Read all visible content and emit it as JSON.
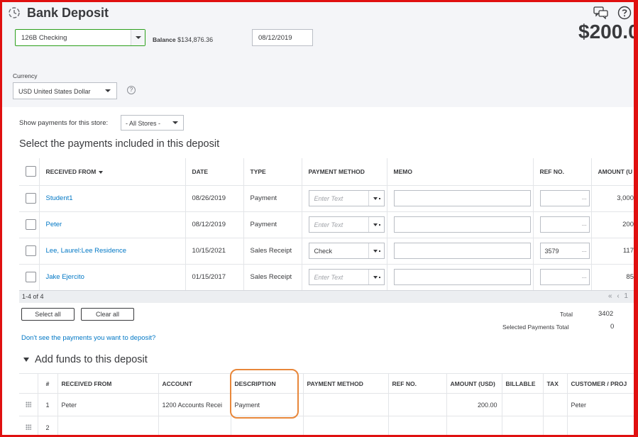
{
  "header": {
    "title": "Bank Deposit",
    "account": "126B Checking",
    "balance_label": "Balance",
    "balance_value": "$134,876.36",
    "date": "08/12/2019",
    "amount": "$200.0",
    "currency_label": "Currency",
    "currency_value": "USD United States Dollar",
    "help_symbol": "?"
  },
  "store": {
    "label": "Show payments for this store:",
    "value": "- All Stores -"
  },
  "payments": {
    "title": "Select the payments included in this deposit",
    "columns": [
      "RECEIVED FROM",
      "DATE",
      "TYPE",
      "PAYMENT METHOD",
      "MEMO",
      "REF NO.",
      "AMOUNT (U"
    ],
    "placeholder": "Enter Text",
    "rows": [
      {
        "received_from": "Student1",
        "date": "08/26/2019",
        "type": "Payment",
        "method": "",
        "memo": "",
        "ref": "",
        "amount": "3,000"
      },
      {
        "received_from": "Peter",
        "date": "08/12/2019",
        "type": "Payment",
        "method": "",
        "memo": "",
        "ref": "",
        "amount": "200"
      },
      {
        "received_from": "Lee, Laurel:Lee Residence",
        "date": "10/15/2021",
        "type": "Sales Receipt",
        "method": "Check",
        "memo": "",
        "ref": "3579",
        "amount": "117"
      },
      {
        "received_from": "Jake Ejercito",
        "date": "01/15/2017",
        "type": "Sales Receipt",
        "method": "",
        "memo": "",
        "ref": "",
        "amount": "85"
      }
    ],
    "pager_count": "1-4 of 4",
    "pager_nav": "« ‹ 1",
    "select_all": "Select all",
    "clear_all": "Clear all",
    "total_label": "Total",
    "total_value": "3402",
    "selected_total_label": "Selected Payments Total",
    "selected_total_value": "0",
    "missing_link": "Don't see the payments you want to deposit?"
  },
  "funds": {
    "title": "Add funds to this deposit",
    "columns": [
      "#",
      "RECEIVED FROM",
      "ACCOUNT",
      "DESCRIPTION",
      "PAYMENT METHOD",
      "REF NO.",
      "AMOUNT (USD)",
      "BILLABLE",
      "TAX",
      "CUSTOMER / PROJ"
    ],
    "rows": [
      {
        "num": "1",
        "received_from": "Peter",
        "account": "1200 Accounts Recei",
        "description": "Payment",
        "method": "",
        "ref": "",
        "amount": "200.00",
        "billable": "",
        "tax": "",
        "customer": "Peter"
      },
      {
        "num": "2",
        "received_from": "",
        "account": "",
        "description": "",
        "method": "",
        "ref": "",
        "amount": "",
        "billable": "",
        "tax": "",
        "customer": ""
      }
    ]
  },
  "colors": {
    "frame": "#e01010",
    "highlight": "#e8873a",
    "link": "#0077c5",
    "accent_green": "#2ca01c"
  },
  "icons": [
    "recurring-clock-icon",
    "chat-feedback-icon",
    "help-circle-icon",
    "chevron-down-icon",
    "sort-down-icon",
    "drag-handle-icon"
  ]
}
